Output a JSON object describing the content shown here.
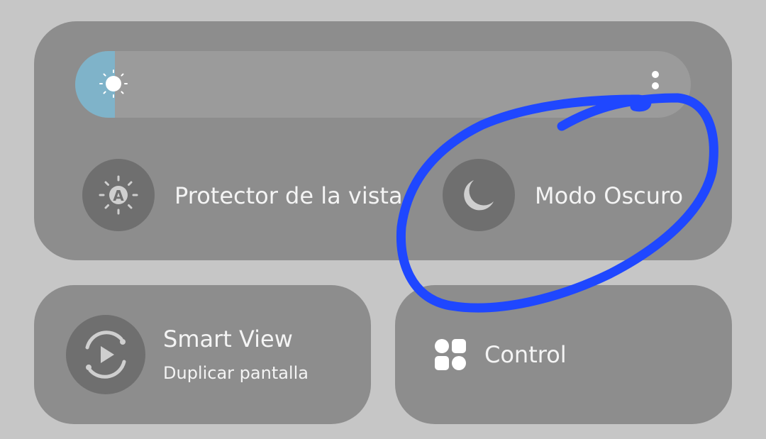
{
  "brightness": {
    "level": 0.065,
    "fill_color": "#7fb3c9",
    "icon": "sun-icon",
    "menu_icon": "more-vertical-icon"
  },
  "toggles": {
    "eye_comfort": {
      "label": "Protector de la vista",
      "icon": "eye-comfort-sun-a-icon"
    },
    "dark_mode": {
      "label": "Modo Oscuro",
      "icon": "moon-icon"
    }
  },
  "smart_view": {
    "title": "Smart View",
    "subtitle": "Duplicar pantalla",
    "icon": "smart-view-play-icon"
  },
  "control": {
    "label": "Control",
    "icon": "four-squares-icon"
  },
  "annotation": {
    "color": "#1f47ff",
    "shape": "hand-drawn circle around Modo Oscuro"
  }
}
